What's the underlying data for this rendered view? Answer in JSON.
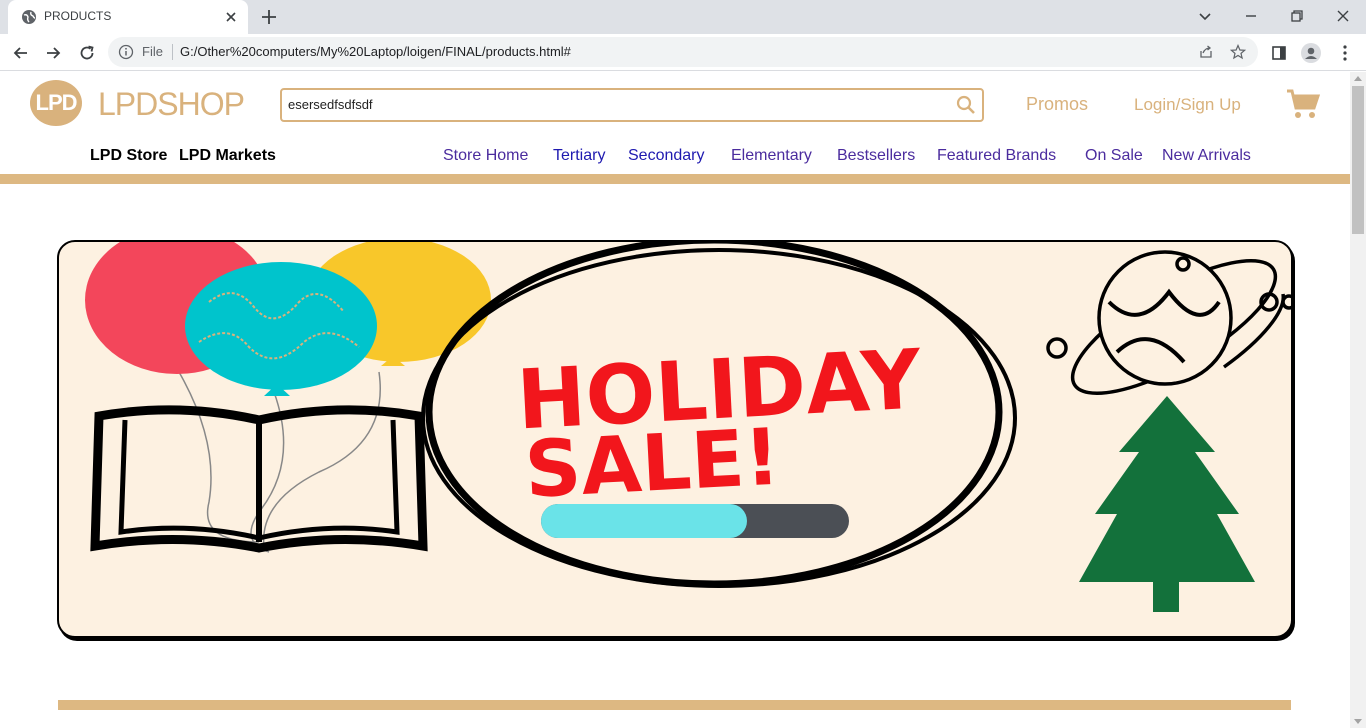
{
  "browser": {
    "tab_title": "PRODUCTS",
    "file_label": "File",
    "url": "G:/Other%20computers/My%20Laptop/loigen/FINAL/products.html#"
  },
  "header": {
    "logo_mark": "LPD",
    "logo_text": "LPDSHOP",
    "search_value": "esersedfsdfsdf",
    "promos_label": "Promos",
    "login_label": "Login/Sign Up"
  },
  "subnav": {
    "left": [
      "LPD Store",
      "LPD Markets"
    ],
    "right": [
      "Store Home",
      "Tertiary",
      "Secondary",
      "Elementary",
      "Bestsellers",
      "Featured Brands",
      "On Sale",
      "New Arrivals"
    ]
  },
  "banner": {
    "line1": "HOLIDAY",
    "line2": "SALE!",
    "progress": 0.67
  },
  "colors": {
    "brand_gold": "#d9b27d",
    "nav_purple": "#4b2c9e",
    "sale_red": "#f2161c",
    "tree_green": "#13713b"
  },
  "icons": {
    "tab_favicon": "globe-icon",
    "search": "search-icon",
    "cart": "shopping-cart-icon"
  }
}
